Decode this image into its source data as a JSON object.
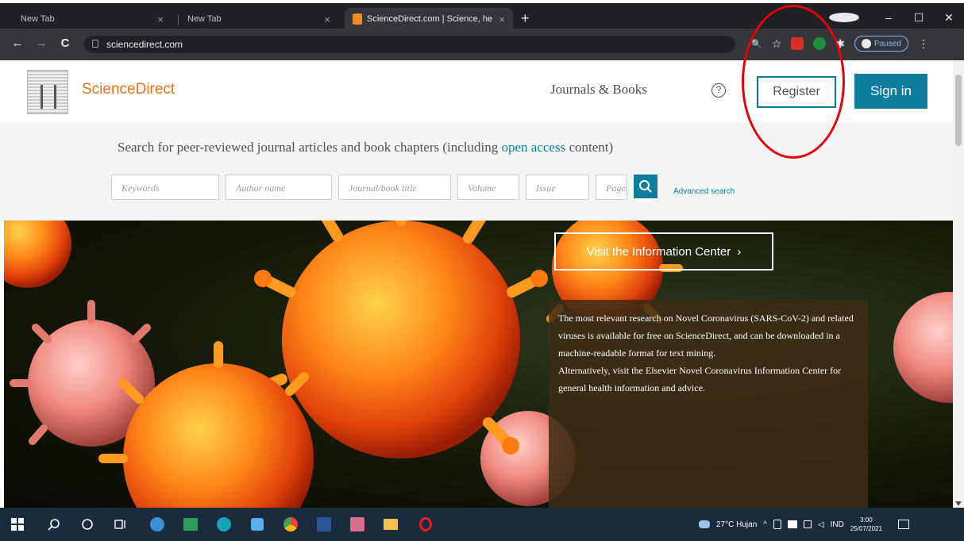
{
  "browser": {
    "tabs": [
      {
        "label": "New Tab",
        "close": "×"
      },
      {
        "label": "New Tab",
        "close": "×"
      },
      {
        "label": "ScienceDirect.com | Science, heal",
        "close": "×"
      }
    ],
    "new_tab": "+",
    "window_controls": [
      "–",
      "☐",
      "✕"
    ],
    "back": "←",
    "forward": "→",
    "reload": "C",
    "url": "sciencedirect.com",
    "zoom_icon": "🔍",
    "star_icon": "☆",
    "extensions_icon": "✱",
    "profile_status": "Paused",
    "menu": "⋮"
  },
  "site": {
    "brand": "ScienceDirect",
    "nav_journals": "Journals & Books",
    "help": "?",
    "register": "Register",
    "sign_in": "Sign in"
  },
  "search": {
    "heading_before": "Search for peer-reviewed journal articles and book chapters (including ",
    "heading_link": "open access",
    "heading_after": " content)",
    "placeholders": {
      "keywords": "Keywords",
      "author": "Author name",
      "journal": "Journal/book title",
      "volume": "Volume",
      "issue": "Issue",
      "pages": "Pages"
    },
    "advanced": "Advanced search"
  },
  "hero": {
    "paragraph1": "The most relevant research on Novel Coronavirus (SARS-CoV-2) and related viruses is available for free on ScienceDirect, and can be downloaded in a machine-readable format for text mining.",
    "paragraph2": "Alternatively, visit the Elsevier Novel Coronavirus Information Center for general health information and advice.",
    "button": "Visit the Information Center",
    "button_arrow": "›"
  },
  "taskbar": {
    "weather": "27°C  Hujan",
    "lang": "IND",
    "time": "3:00",
    "date": "25/07/2021"
  },
  "colors": {
    "accent": "#0c7d9d",
    "brand_orange": "#e9711c",
    "annotation_red": "#e3000b"
  }
}
